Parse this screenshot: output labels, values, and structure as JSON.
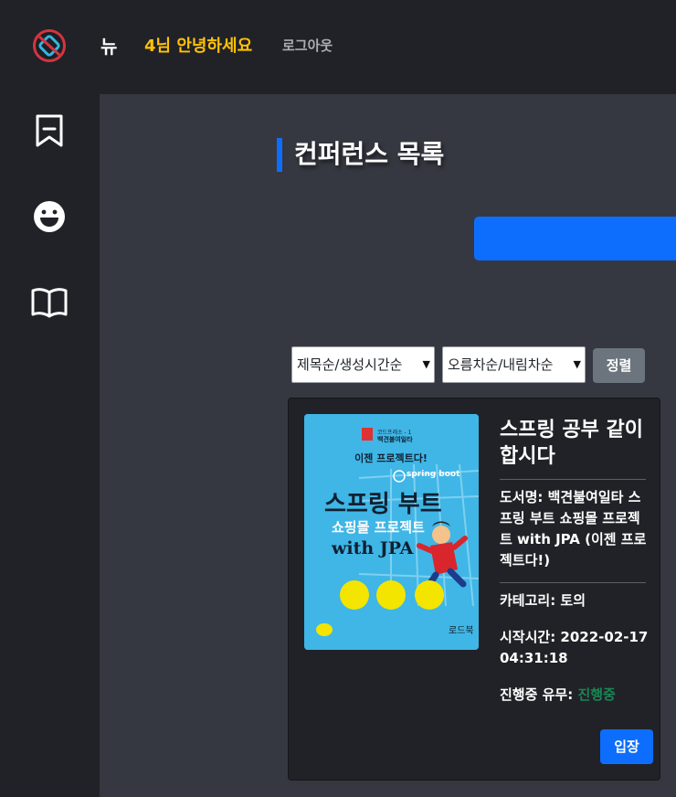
{
  "header": {
    "menu_label": "뉴",
    "greeting": "4님 안녕하세요",
    "logout_label": "로그아웃"
  },
  "sidebar": {
    "items": [
      {
        "icon": "bookmark-icon"
      },
      {
        "icon": "smile-icon"
      },
      {
        "icon": "book-icon"
      }
    ]
  },
  "main": {
    "title": "컨퍼런스 목록",
    "sort_field": "제목순/생성시간순",
    "sort_order": "오름차순/내림차순",
    "sort_button": "정렬"
  },
  "cover": {
    "top_line_1": "코드프레소 - 1",
    "top_line_2": "백견불여일타",
    "tagline": "이젠 프로젝트다!",
    "badge": "spring boot",
    "title_line_1": "스프링 부트",
    "title_line_2": "쇼핑몰 프로젝트",
    "title_line_3": "with JPA",
    "publisher": "로드북"
  },
  "card": {
    "title": "스프링 공부 같이 합시다",
    "book": "도서명: 백견불여일타 스프링 부트 쇼핑몰 프로젝트 with JPA (이젠 프로젝트다!)",
    "category": "카테고리: 토의",
    "start_time": "시작시간: 2022-02-17 04:31:18",
    "status_label": "진행중 유무: ",
    "status_value": "진행중",
    "enter_button": "입장"
  },
  "colors": {
    "accent": "#0d6efd",
    "greeting": "#ffc107",
    "status": "#198754",
    "panel": "#202227",
    "background": "#353840"
  }
}
